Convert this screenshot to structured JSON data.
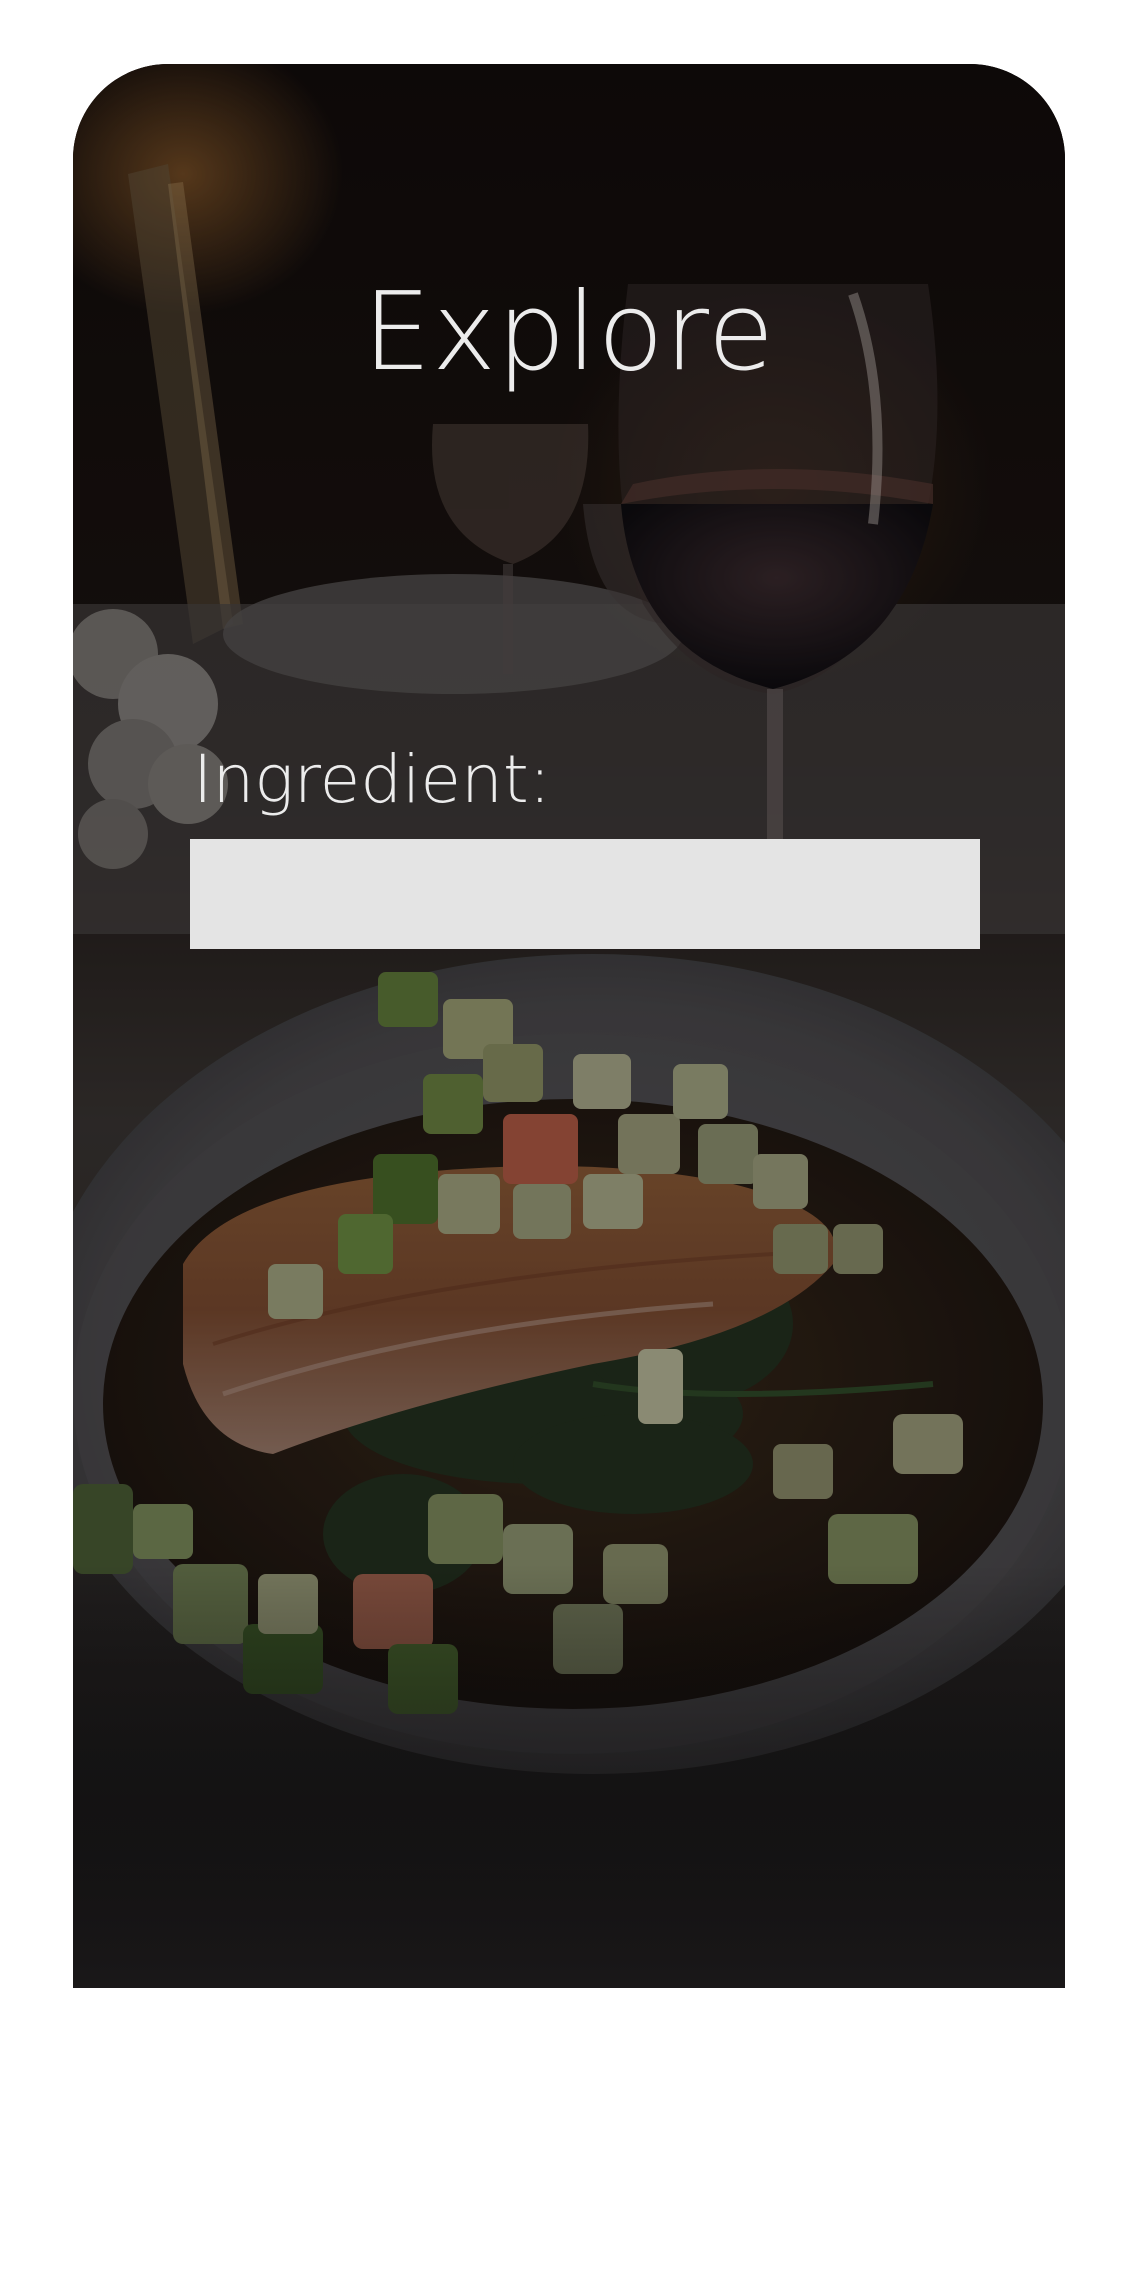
{
  "screen": {
    "title": "Explore",
    "background_image": "plated-salmon-dinner-photo"
  },
  "form": {
    "ingredient_label": "Ingredient:",
    "ingredient_value": "",
    "ingredient_placeholder": ""
  },
  "colors": {
    "page_background": "#ffffff",
    "text": "#ececec",
    "input_background": "#e4e4e4"
  }
}
